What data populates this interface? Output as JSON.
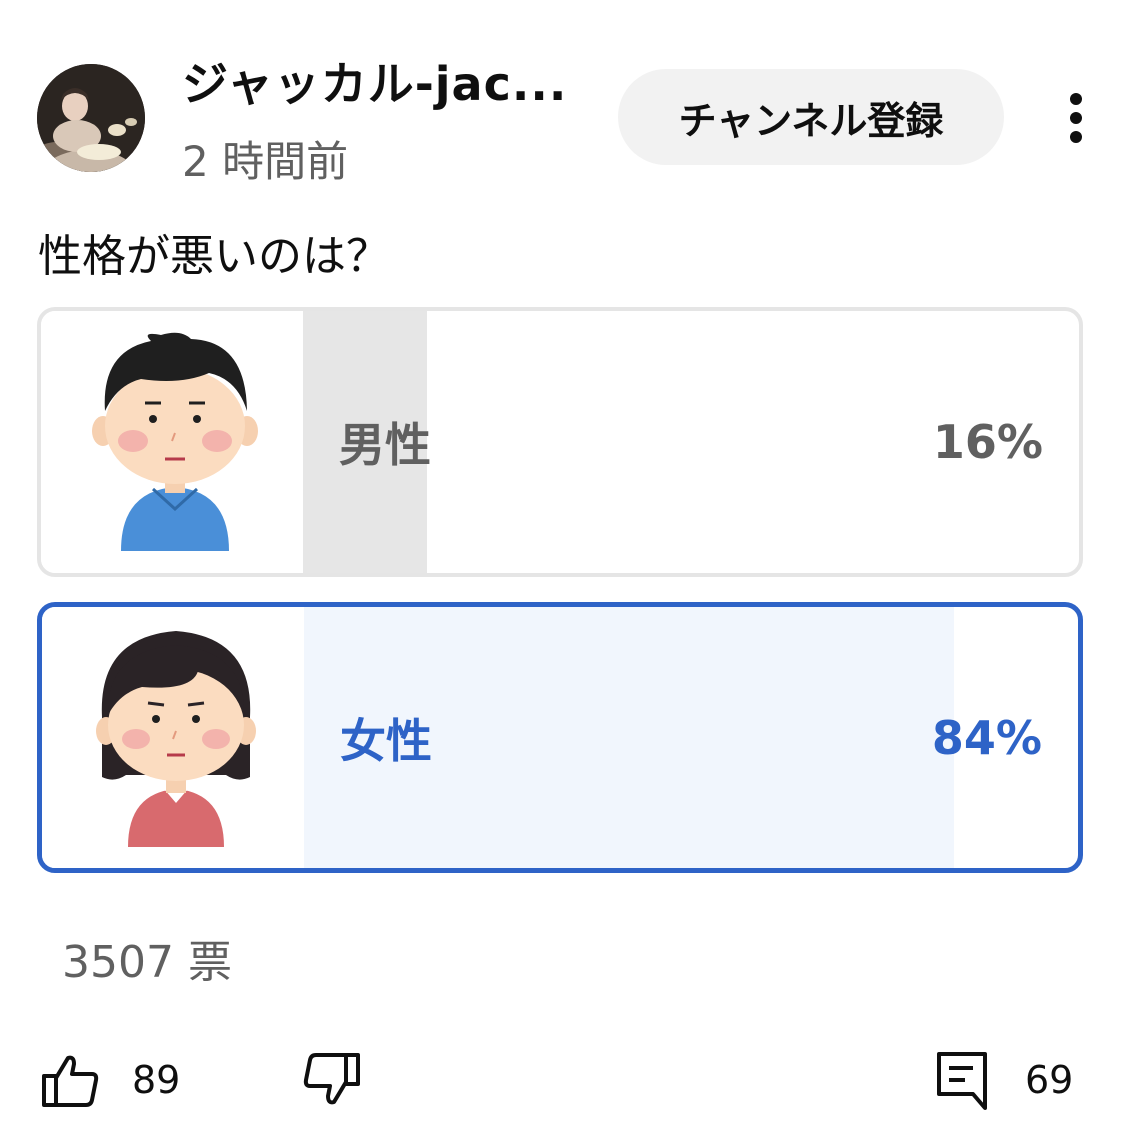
{
  "header": {
    "channel_name": "ジャッカル-jac...",
    "time_ago": "2 時間前",
    "subscribe_label": "チャンネル登録"
  },
  "poll": {
    "question": "性格が悪いのは？",
    "options": [
      {
        "label": "男性",
        "percent_text": "16%",
        "percent": 16,
        "selected": false,
        "image": "man-illustration"
      },
      {
        "label": "女性",
        "percent_text": "84%",
        "percent": 84,
        "selected": true,
        "image": "woman-illustration"
      }
    ],
    "votes": "3507 票"
  },
  "actions": {
    "likes": "89",
    "comments": "69"
  },
  "colors": {
    "accent_blue": "#2e63c7",
    "selected_fill": "#f1f6fd",
    "unselected_fill": "#e6e6e6",
    "secondary_text": "#606060"
  },
  "icons": {
    "like": "thumbs-up-icon",
    "dislike": "thumbs-down-icon",
    "comments": "comment-icon",
    "more": "more-vert-icon"
  }
}
